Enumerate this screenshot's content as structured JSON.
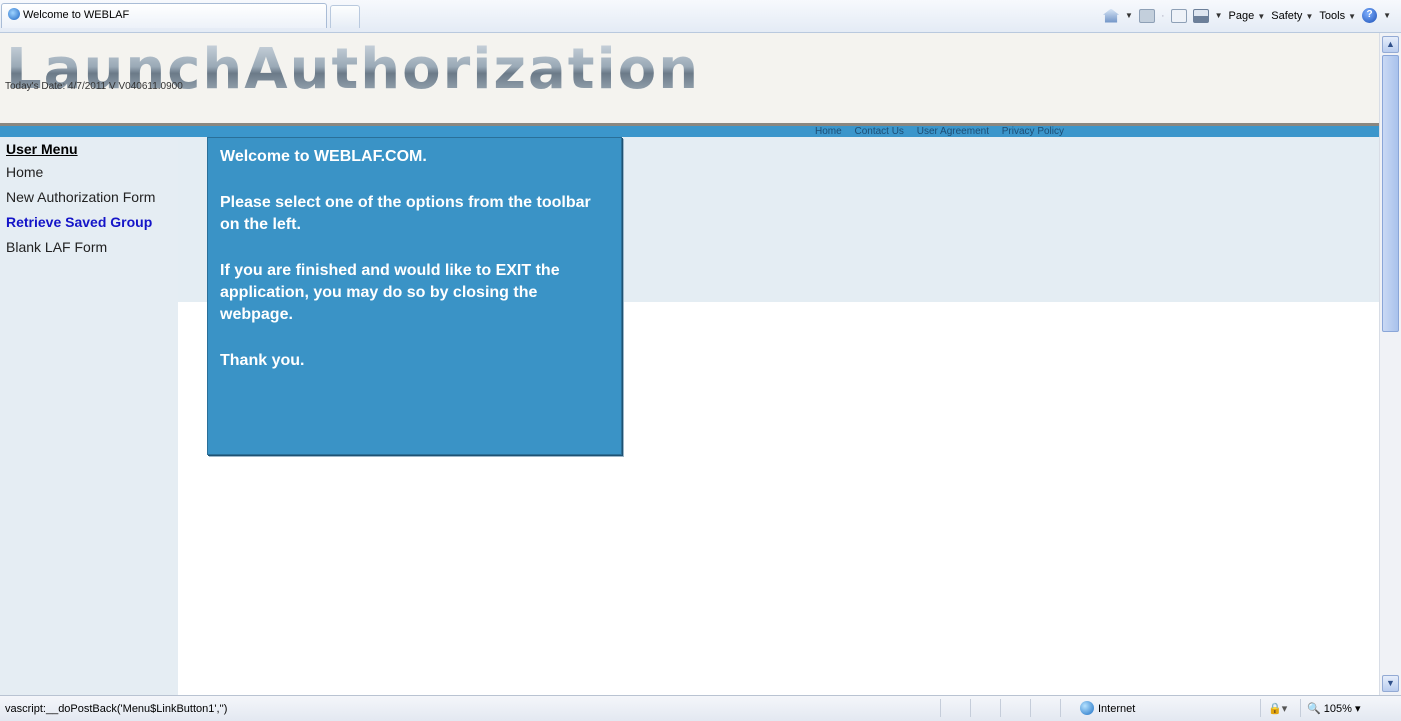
{
  "browser": {
    "tab_title": "Welcome to WEBLAF",
    "commands": {
      "page": "Page",
      "safety": "Safety",
      "tools": "Tools"
    }
  },
  "header": {
    "logo_text": "LaunchAuthorization",
    "date_line": "Today's Date: 4/7/2011 V V040611.0900"
  },
  "top_nav": [
    "Home",
    "Contact Us",
    "User Agreement",
    "Privacy Policy"
  ],
  "sidebar": {
    "title": "User Menu",
    "items": [
      {
        "label": "Home",
        "active": false
      },
      {
        "label": "New Authorization Form",
        "active": false
      },
      {
        "label": "Retrieve Saved Group",
        "active": true
      },
      {
        "label": "Blank LAF Form",
        "active": false
      }
    ]
  },
  "welcome": {
    "title": "Welcome to WEBLAF.COM.",
    "line1": "Please select one of the options from the toolbar on the left.",
    "line2": "If you are finished and would like to EXIT the application, you may do so by closing the webpage.",
    "line3": "Thank you."
  },
  "status_bar": {
    "text": "vascript:__doPostBack('Menu$LinkButton1','')",
    "zone": "Internet",
    "zoom": "105%"
  },
  "colors": {
    "accent_blue": "#3a93c6",
    "link_active": "#1414c8",
    "sidebar_bg": "#e5edf3"
  }
}
